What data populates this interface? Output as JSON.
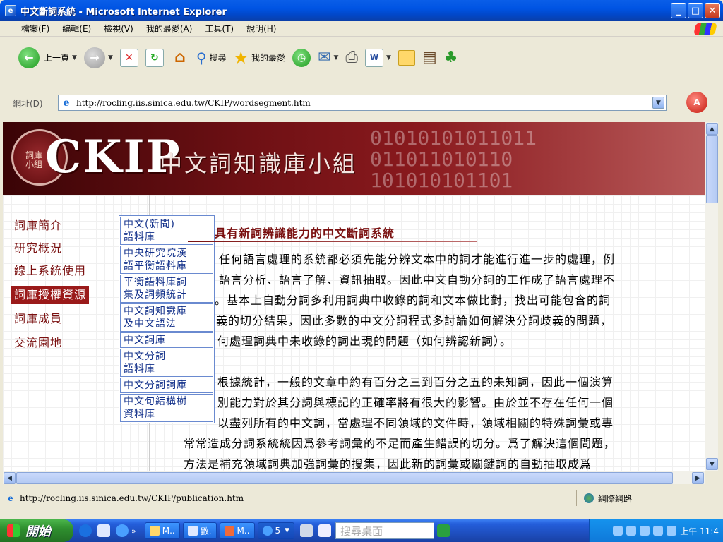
{
  "window": {
    "title": "中文斷詞系統 - Microsoft Internet Explorer",
    "controls": {
      "minimize": "_",
      "maximize": "□",
      "close": "✕"
    }
  },
  "menu": {
    "items": [
      "檔案(F)",
      "編輯(E)",
      "檢視(V)",
      "我的最愛(A)",
      "工具(T)",
      "說明(H)"
    ]
  },
  "toolbar": {
    "back": "上一頁",
    "search": "搜尋",
    "favorites": "我的最愛"
  },
  "address": {
    "label": "網址(D)",
    "url": "http://rocling.iis.sinica.edu.tw/CKIP/wordsegment.htm"
  },
  "banner": {
    "logo_mark": "詞庫小組",
    "logo_text": "CKIP",
    "title": "中文詞知識庫小組",
    "bits": "01010101011011\n011011010110\n101010101101"
  },
  "nav": {
    "items": [
      "詞庫簡介",
      "研究概況",
      "線上系統使用",
      "詞庫授權資源",
      "詞庫成員",
      "交流園地"
    ],
    "active_index": 3
  },
  "submenu": {
    "items": [
      [
        "中文(新聞)",
        "語料庫"
      ],
      [
        "中央研究院漢",
        "語平衡語料庫"
      ],
      [
        "平衡語料庫詞",
        "集及詞頻統計"
      ],
      [
        "中文詞知識庫",
        "及中文語法"
      ],
      [
        "中文詞庫"
      ],
      [
        "中文分詞",
        "語料庫"
      ],
      [
        "中文分詞詞庫"
      ],
      [
        "中文句結構樹",
        "資料庫"
      ]
    ]
  },
  "article": {
    "heading": "具有新詞辨識能力的中文斷詞系統",
    "paragraphs": [
      "任何語言處理的系統都必須先能分辨文本中的詞才能進行進一步的處理，例",
      "語言分析、語言了解、資訊抽取。因此中文自動分詞的工作成了語言處理不",
      "。基本上自動分詞多利用詞典中收錄的詞和文本做比對，找出可能包含的詞",
      "義的切分結果，因此多數的中文分詞程式多討論如何解決分詞歧義的問題，",
      "何處理詞典中未收錄的詞出現的問題（如何辨認新詞）。",
      "",
      "根據統計，一般的文章中約有百分之三到百分之五的未知詞，因此一個演算",
      "別能力對於其分詞與標記的正確率將有很大的影響。由於並不存在任何一個",
      "以盡列所有的中文詞，當處理不同領域的文件時，領域相關的特殊詞彙或專",
      "常常造成分詞系統統因爲參考詞彙的不足而產生錯誤的切分。爲了解決這個問題，",
      "方法是補充領域詞典加強詞彙的搜集，因此新的詞彙或關鍵詞的自動抽取成爲"
    ]
  },
  "status": {
    "url": "http://rocling.iis.sinica.edu.tw/CKIP/publication.htm",
    "zone": "網際網路"
  },
  "taskbar": {
    "start": "開始",
    "tasks": [
      "M..",
      "數.",
      "M..",
      "5"
    ],
    "deskbar_placeholder": "搜尋桌面",
    "clock": "上午 11:4"
  }
}
